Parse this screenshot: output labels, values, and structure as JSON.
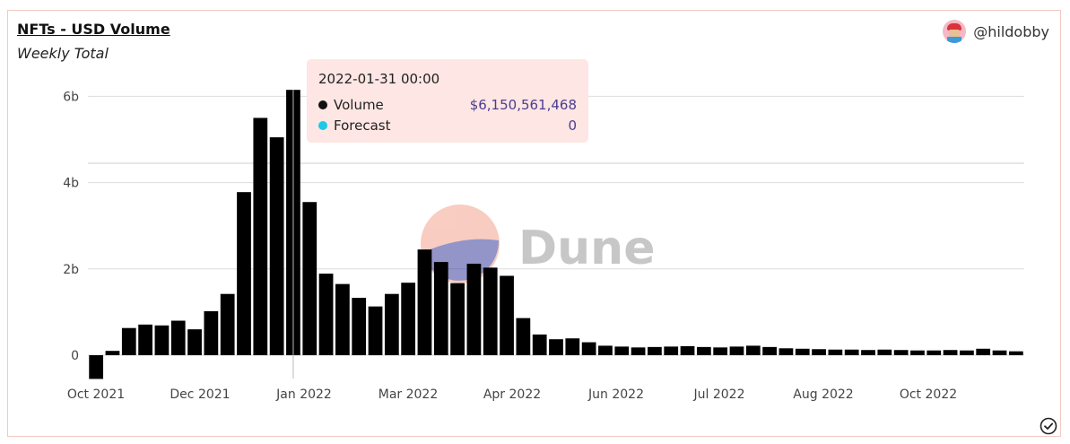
{
  "header": {
    "title": "NFTs - USD Volume",
    "subtitle": "Weekly Total",
    "author": "@hildobby"
  },
  "tooltip": {
    "date": "2022-01-31 00:00",
    "rows": [
      {
        "label": "Volume",
        "value": "$6,150,561,468",
        "color": "#111111"
      },
      {
        "label": "Forecast",
        "value": "0",
        "color": "#1ec8e6"
      }
    ]
  },
  "watermark": {
    "text": "Dune"
  },
  "colors": {
    "bar": "#000000",
    "grid": "#dddddd",
    "card_border": "#f2c9bf",
    "tooltip_bg": "#fde6e3"
  },
  "chart_data": {
    "type": "bar",
    "x_tick_labels": [
      "Oct 2021",
      "Dec 2021",
      "Jan 2022",
      "Mar 2022",
      "Apr 2022",
      "Jun 2022",
      "Jul 2022",
      "Aug 2022",
      "Oct 2022"
    ],
    "y_tick_labels": [
      "0",
      "2b",
      "4b",
      "6b"
    ],
    "y_ticks": [
      0,
      2,
      4,
      6
    ],
    "ylim": [
      -0.6,
      6.3
    ],
    "grid": true,
    "series": [
      {
        "name": "Volume",
        "values": [
          -0.55,
          0.1,
          0.63,
          0.71,
          0.69,
          0.8,
          0.6,
          1.02,
          1.42,
          3.78,
          5.5,
          5.05,
          6.15,
          3.55,
          1.89,
          1.65,
          1.33,
          1.13,
          1.42,
          1.68,
          2.45,
          2.16,
          1.67,
          2.12,
          2.03,
          1.84,
          0.86,
          0.48,
          0.37,
          0.39,
          0.3,
          0.22,
          0.2,
          0.18,
          0.19,
          0.2,
          0.21,
          0.19,
          0.18,
          0.2,
          0.22,
          0.19,
          0.16,
          0.15,
          0.14,
          0.13,
          0.13,
          0.12,
          0.13,
          0.12,
          0.11,
          0.11,
          0.12,
          0.11,
          0.15,
          0.11,
          0.09
        ]
      },
      {
        "name": "Forecast",
        "values": []
      }
    ],
    "highlight": {
      "label": "2022-01-31 00:00",
      "index": 12
    }
  }
}
